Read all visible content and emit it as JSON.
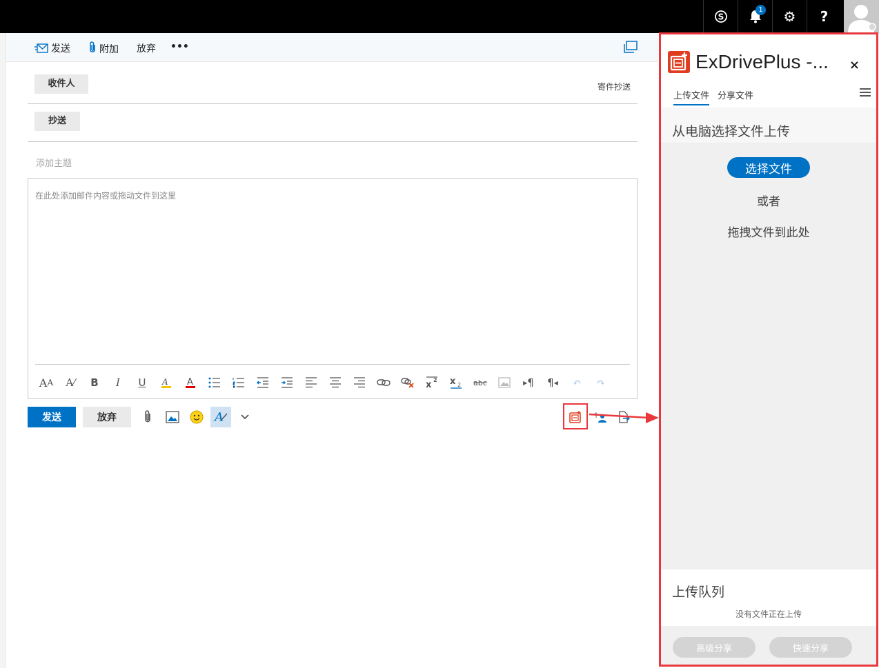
{
  "topbar": {
    "skype_glyph": "S",
    "notification_count": "1",
    "settings_glyph": "⚙",
    "help_glyph": "?"
  },
  "command_bar": {
    "send": "发送",
    "attach": "附加",
    "discard": "放弃",
    "more": "•••"
  },
  "compose": {
    "to_label": "收件人",
    "cc_label": "抄送",
    "bcc_link": "寄件抄送",
    "subject_placeholder": "添加主题",
    "body_placeholder": "在此处添加邮件内容或拖动文件到这里"
  },
  "actions": {
    "send": "发送",
    "discard": "放弃"
  },
  "addin": {
    "title": "ExDrivePlus -...",
    "close": "×",
    "tabs": [
      "上传文件",
      "分享文件"
    ],
    "section_title": "从电脑选择文件上传",
    "choose_button": "选择文件",
    "or_text": "或者",
    "drag_text": "拖拽文件到此处",
    "queue_title": "上传队列",
    "queue_status": "没有文件正在上传",
    "advanced_share": "高级分享",
    "quick_share": "快速分享"
  },
  "colors": {
    "accent": "#0072c6",
    "highlight": "#e8383d",
    "logo": "#e03c1f"
  }
}
